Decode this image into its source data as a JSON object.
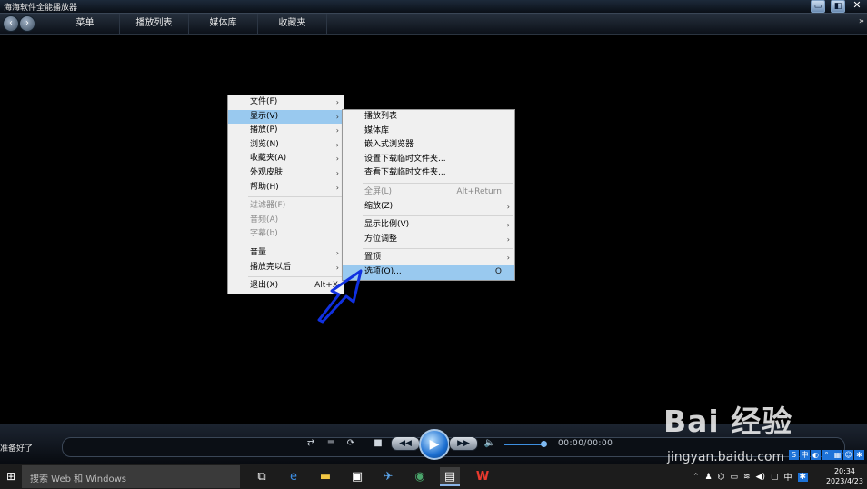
{
  "window": {
    "title": "海海软件全能播放器",
    "buttons": [
      "▭",
      "◧",
      "✕"
    ]
  },
  "menubar": {
    "items": [
      "菜单",
      "播放列表",
      "媒体库",
      "收藏夹"
    ],
    "more": "»"
  },
  "main_menu": {
    "items": [
      {
        "label": "文件(F)",
        "arrow": "›"
      },
      {
        "label": "显示(V)",
        "arrow": "›",
        "highlighted": true
      },
      {
        "label": "播放(P)",
        "arrow": "›"
      },
      {
        "label": "浏览(N)",
        "arrow": "›"
      },
      {
        "label": "收藏夹(A)",
        "arrow": "›"
      },
      {
        "label": "外观皮肤",
        "arrow": "›"
      },
      {
        "label": "帮助(H)",
        "arrow": "›"
      },
      {
        "label": "过滤器(F)",
        "disabled": true
      },
      {
        "label": "音频(A)",
        "disabled": true
      },
      {
        "label": "字幕(b)",
        "disabled": true
      },
      {
        "label": "音量",
        "arrow": "›"
      },
      {
        "label": "播放完以后",
        "arrow": "›"
      },
      {
        "label": "退出(X)",
        "shortcut": "Alt+X"
      }
    ]
  },
  "sub_menu": {
    "items": [
      {
        "label": "播放列表"
      },
      {
        "label": "媒体库"
      },
      {
        "label": "嵌入式浏览器"
      },
      {
        "label": "设置下载临时文件夹..."
      },
      {
        "label": "查看下载临时文件夹..."
      },
      {
        "label": "全屏(L)",
        "shortcut": "Alt+Return",
        "disabled": true
      },
      {
        "label": "缩放(Z)",
        "arrow": "›"
      },
      {
        "label": "显示比例(V)",
        "arrow": "›"
      },
      {
        "label": "方位调整",
        "arrow": "›"
      },
      {
        "label": "置顶",
        "arrow": "›"
      },
      {
        "label": "选项(O)...",
        "shortcut": "O",
        "highlighted": true
      }
    ]
  },
  "player": {
    "status": "准备好了",
    "time": "00:00/00:00",
    "volume_level": 0.9,
    "controls": {
      "stop": "■",
      "prev": "◀◀",
      "play": "▶",
      "next": "▶▶",
      "volume": "🔈",
      "shuffle": "⇄",
      "playlist": "≡",
      "repeat": "⟳"
    }
  },
  "watermark": {
    "brand": "Bai 经验",
    "url": "jingyan.baidu.com"
  },
  "taskbar": {
    "start": "⊞",
    "search_placeholder": "搜索 Web 和 Windows",
    "clock_time": "20:34",
    "clock_date": "2023/4/23",
    "tray_lang": "中"
  },
  "colors": {
    "menu_highlight": "#99c9ef",
    "accent": "#1c6fd1"
  }
}
